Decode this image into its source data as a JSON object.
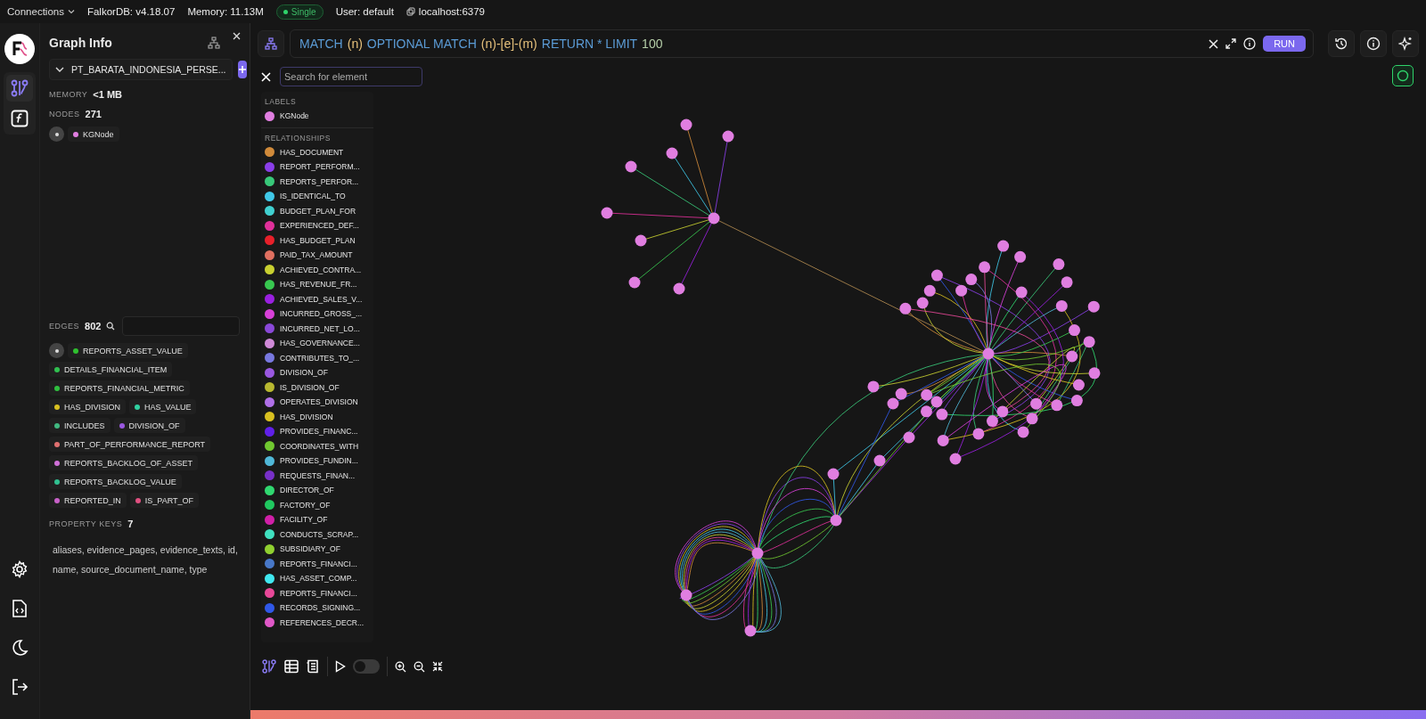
{
  "top_bar": {
    "connections": "Connections",
    "version": "FalkorDB: v4.18.07",
    "memory": "Memory: 11.13M",
    "mode": "Single",
    "user": "User: default",
    "host": "localhost:6379"
  },
  "rail": {
    "top": [
      {
        "kind": "graph",
        "selected": true
      },
      {
        "kind": "function",
        "selected": false
      }
    ],
    "bottom": [
      {
        "kind": "settings"
      },
      {
        "kind": "code-file"
      },
      {
        "kind": "theme"
      },
      {
        "kind": "logout"
      }
    ]
  },
  "graph_info": {
    "title": "Graph Info",
    "graph": "PT_BARATA_INDONESIA_PERSE...",
    "memory_label": "MEMORY",
    "memory": "<1 MB",
    "nodes_label": "NODES",
    "nodes": "271",
    "node_labels": [
      {
        "name": "KGNode",
        "color": "#e07ee0"
      }
    ],
    "edges_label": "EDGES",
    "edges": "802",
    "edge_types": [
      {
        "name": "REPORTS_ASSET_VALUE",
        "color": "#2fc02f"
      },
      {
        "name": "DETAILS_FINANCIAL_ITEM",
        "color": "#30c050"
      },
      {
        "name": "REPORTS_FINANCIAL_METRIC",
        "color": "#2fbf3f"
      },
      {
        "name": "HAS_DIVISION",
        "color": "#d8c020"
      },
      {
        "name": "HAS_VALUE",
        "color": "#30d0a0"
      },
      {
        "name": "INCLUDES",
        "color": "#40b880"
      },
      {
        "name": "DIVISION_OF",
        "color": "#9a58e0"
      },
      {
        "name": "PART_OF_PERFORMANCE_REPORT",
        "color": "#e07070"
      },
      {
        "name": "REPORTS_BACKLOG_OF_ASSET",
        "color": "#d070d8"
      },
      {
        "name": "REPORTS_BACKLOG_VALUE",
        "color": "#30c090"
      },
      {
        "name": "REPORTED_IN",
        "color": "#c860c8"
      },
      {
        "name": "IS_PART_OF",
        "color": "#e05080"
      }
    ],
    "property_keys_label": "PROPERTY KEYS",
    "property_keys": "7",
    "keys_text": "aliases, evidence_pages, evidence_texts, id, name, source_document_name, type"
  },
  "query": {
    "tokens": [
      {
        "text": "MATCH",
        "kind": "keyword"
      },
      {
        "text": "(n)",
        "kind": "variable"
      },
      {
        "text": "OPTIONAL MATCH",
        "kind": "keyword"
      },
      {
        "text": "(n)-[e]-(m)",
        "kind": "variable"
      },
      {
        "text": "RETURN * LIMIT",
        "kind": "keyword"
      },
      {
        "text": "100",
        "kind": "number"
      }
    ],
    "run": "RUN"
  },
  "canvas": {
    "search": {
      "placeholder": "Search for element"
    },
    "labels": {
      "title": "LABELS",
      "items": [
        {
          "name": "KGNode",
          "color": "#e07ee0"
        }
      ]
    },
    "relationships": {
      "title": "RELATIONSHIPS",
      "items": [
        {
          "name": "HAS_DOCUMENT",
          "color": "#d08a3a"
        },
        {
          "name": "REPORT_PERFORM...",
          "color": "#8a3ee8"
        },
        {
          "name": "REPORTS_PERFOR...",
          "color": "#38c879"
        },
        {
          "name": "IS_IDENTICAL_TO",
          "color": "#40c8e8"
        },
        {
          "name": "BUDGET_PLAN_FOR",
          "color": "#40d0d0"
        },
        {
          "name": "EXPERIENCED_DEF...",
          "color": "#e0309a"
        },
        {
          "name": "HAS_BUDGET_PLAN",
          "color": "#e8202a"
        },
        {
          "name": "PAID_TAX_AMOUNT",
          "color": "#e07060"
        },
        {
          "name": "ACHIEVED_CONTRA...",
          "color": "#c8d030"
        },
        {
          "name": "HAS_REVENUE_FR...",
          "color": "#38c850"
        },
        {
          "name": "ACHIEVED_SALES_V...",
          "color": "#9a20e0"
        },
        {
          "name": "INCURRED_GROSS_...",
          "color": "#d840d8"
        },
        {
          "name": "INCURRED_NET_LO...",
          "color": "#8a48d8"
        },
        {
          "name": "HAS_GOVERNANCE...",
          "color": "#d08ad8"
        },
        {
          "name": "CONTRIBUTES_TO_...",
          "color": "#7878e0"
        },
        {
          "name": "DIVISION_OF",
          "color": "#9a58e0"
        },
        {
          "name": "IS_DIVISION_OF",
          "color": "#b8b830"
        },
        {
          "name": "OPERATES_DIVISION",
          "color": "#b070e8"
        },
        {
          "name": "HAS_DIVISION",
          "color": "#d8c020"
        },
        {
          "name": "PROVIDES_FINANC...",
          "color": "#6020e8"
        },
        {
          "name": "COORDINATES_WITH",
          "color": "#70c830"
        },
        {
          "name": "PROVIDES_FUNDIN...",
          "color": "#50b8d8"
        },
        {
          "name": "REQUESTS_FINAN...",
          "color": "#7830c8"
        },
        {
          "name": "DIRECTOR_OF",
          "color": "#30d870"
        },
        {
          "name": "FACTORY_OF",
          "color": "#20c860"
        },
        {
          "name": "FACILITY_OF",
          "color": "#d020a8"
        },
        {
          "name": "CONDUCTS_SCRAP...",
          "color": "#40e0c0"
        },
        {
          "name": "SUBSIDIARY_OF",
          "color": "#90d030"
        },
        {
          "name": "REPORTS_FINANCI...",
          "color": "#4878c8"
        },
        {
          "name": "HAS_ASSET_COMP...",
          "color": "#40e8f0"
        },
        {
          "name": "REPORTS_FINANCI...",
          "color": "#e84898"
        },
        {
          "name": "RECORDS_SIGNING...",
          "color": "#3058e8"
        },
        {
          "name": "REFERENCES_DECR...",
          "color": "#e058c8"
        }
      ]
    }
  },
  "toolbar": {
    "views": [
      {
        "kind": "graph",
        "selected": true
      },
      {
        "kind": "table",
        "selected": false
      },
      {
        "kind": "metadata",
        "selected": false
      }
    ],
    "animation_on": false
  }
}
